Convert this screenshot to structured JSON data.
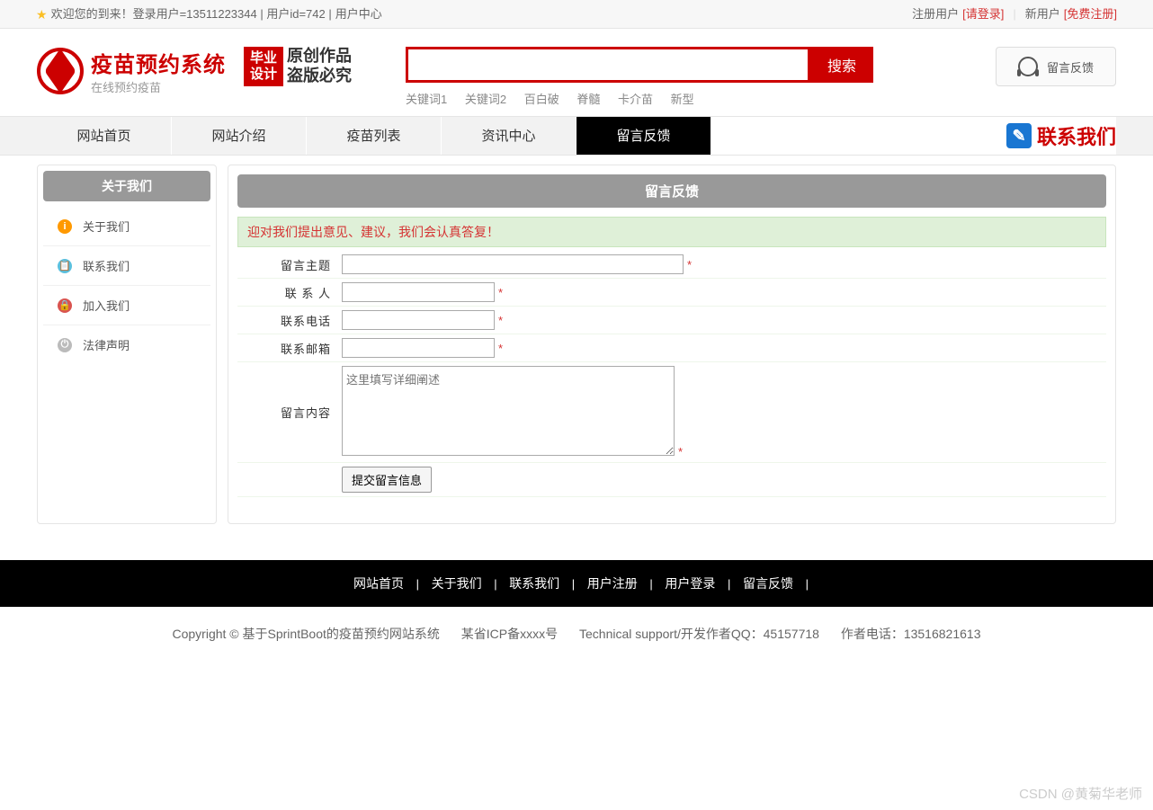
{
  "topbar": {
    "welcome": "欢迎您的到来！登录用户=13511223344 | 用户id=742 | ",
    "user_center": "用户中心",
    "reg_label": "注册用户",
    "login_link": "[请登录]",
    "new_user_label": "新用户",
    "free_reg": "[免费注册]"
  },
  "logo": {
    "title": "疫苗预约系统",
    "subtitle": "在线预约疫苗",
    "badge1": "毕业",
    "badge2": "设计",
    "script1": "原创作品",
    "script2": "盗版必究"
  },
  "search": {
    "placeholder": "",
    "button": "搜索",
    "keywords": [
      "关键词1",
      "关键词2",
      "百白破",
      "脊髓",
      "卡介苗",
      "新型"
    ]
  },
  "feedback_button": "留言反馈",
  "nav": {
    "items": [
      "网站首页",
      "网站介绍",
      "疫苗列表",
      "资讯中心",
      "留言反馈"
    ],
    "active_index": 4,
    "contact": "联系我们"
  },
  "sidebar": {
    "title": "关于我们",
    "items": [
      {
        "label": "关于我们",
        "icon": "info"
      },
      {
        "label": "联系我们",
        "icon": "contact"
      },
      {
        "label": "加入我们",
        "icon": "join"
      },
      {
        "label": "法律声明",
        "icon": "legal"
      }
    ]
  },
  "panel": {
    "title": "留言反馈",
    "notice": "迎对我们提出意见、建议，我们会认真答复！",
    "fields": {
      "subject": "留言主题",
      "contact_person": "联 系 人",
      "phone": "联系电话",
      "email": "联系邮箱",
      "content": "留言内容",
      "content_placeholder": "这里填写详细阐述"
    },
    "submit": "提交留言信息",
    "required_mark": "*"
  },
  "footer": {
    "nav": [
      "网站首页",
      "关于我们",
      "联系我们",
      "用户注册",
      "用户登录",
      "留言反馈"
    ],
    "copyright": "Copyright © 基于SprintBoot的疫苗预约网站系统",
    "icp": "某省ICP备xxxx号",
    "support": "Technical support/开发作者QQ：45157718",
    "author_phone": "作者电话：13516821613"
  },
  "watermark": "CSDN @黄菊华老师"
}
